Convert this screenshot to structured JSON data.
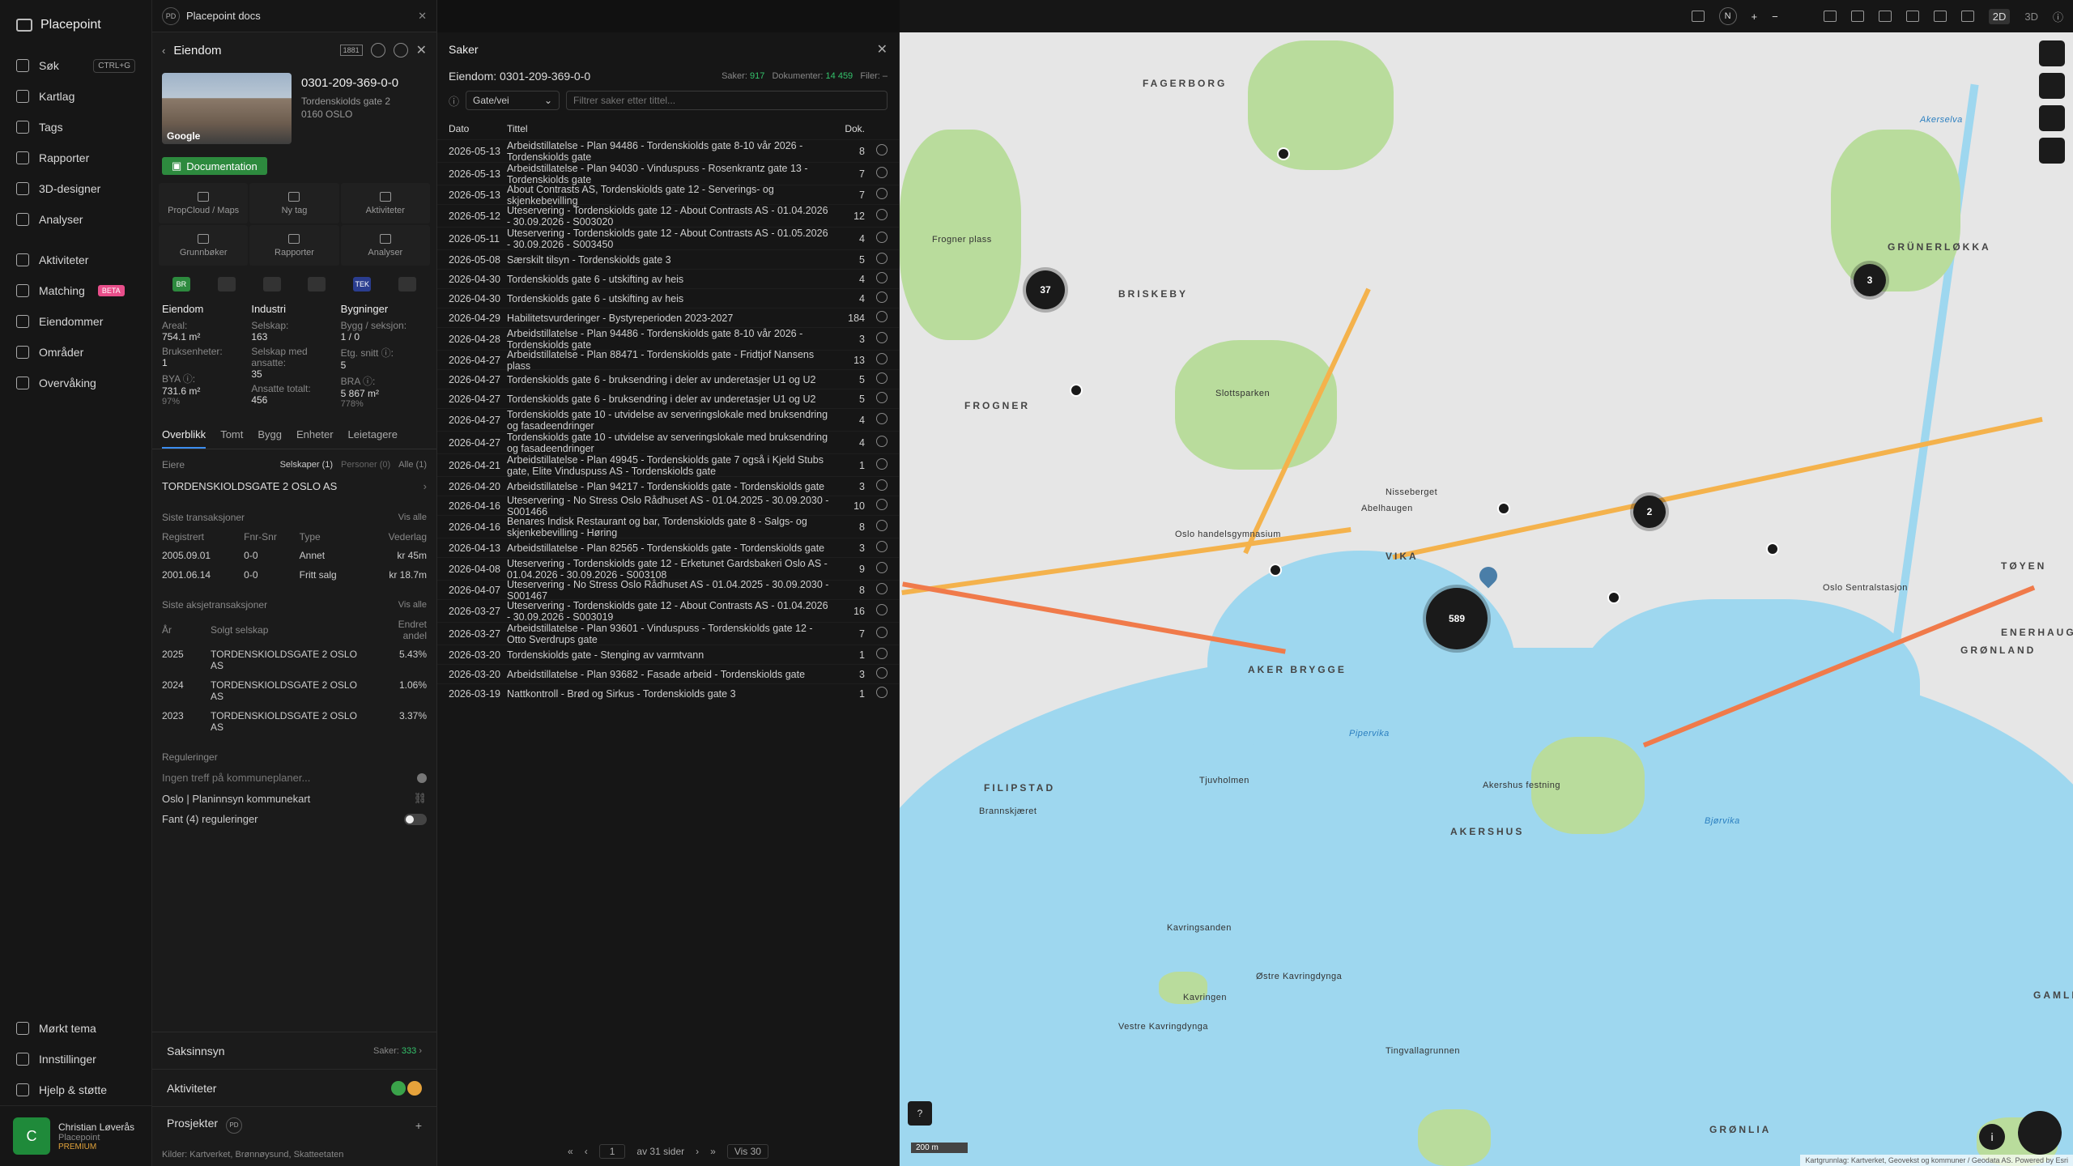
{
  "nav": {
    "brand": "Placepoint",
    "items": [
      {
        "label": "Søk",
        "kbd": "CTRL+G"
      },
      {
        "label": "Kartlag"
      },
      {
        "label": "Tags"
      },
      {
        "label": "Rapporter"
      },
      {
        "label": "3D-designer"
      },
      {
        "label": "Analyser"
      }
    ],
    "items2": [
      {
        "label": "Aktiviteter"
      },
      {
        "label": "Matching",
        "beta": "BETA"
      },
      {
        "label": "Eiendommer"
      },
      {
        "label": "Områder"
      },
      {
        "label": "Overvåking"
      }
    ],
    "bottom": [
      {
        "label": "Mørkt tema"
      },
      {
        "label": "Innstillinger"
      },
      {
        "label": "Hjelp & støtte"
      }
    ],
    "user": {
      "initial": "C",
      "name": "Christian Løverås",
      "org": "Placepoint",
      "plan": "PREMIUM"
    }
  },
  "topbar": {
    "badge": "PD",
    "doc_title": "Placepoint docs"
  },
  "property": {
    "header": "Eiendom",
    "header_badge": "1881",
    "id": "0301-209-369-0-0",
    "address_line1": "Tordenskiolds gate 2",
    "address_line2": "0160 OSLO",
    "photo_label": "Google",
    "doc_button": "Documentation",
    "actions": [
      "PropCloud / Maps",
      "Ny tag",
      "Aktiviteter",
      "Grunnbøker",
      "Rapporter",
      "Analyser"
    ],
    "chips": [
      "BR",
      "",
      "",
      "",
      "TEK",
      ""
    ],
    "stats": {
      "col1": {
        "head": "Eiendom",
        "rows": [
          [
            "Areal:",
            "754.1 m²"
          ],
          [
            "Bruksenheter:",
            "1"
          ],
          [
            "BYA ⓘ:",
            "731.6 m²"
          ]
        ],
        "note": "97%"
      },
      "col2": {
        "head": "Industri",
        "rows": [
          [
            "Selskap:",
            "163"
          ],
          [
            "Selskap med ansatte:",
            "35"
          ],
          [
            "Ansatte totalt:",
            "456"
          ]
        ]
      },
      "col3": {
        "head": "Bygninger",
        "rows": [
          [
            "Bygg / seksjon:",
            "1 / 0"
          ],
          [
            "Etg. snitt ⓘ:",
            "5"
          ],
          [
            "BRA ⓘ:",
            "5 867 m²"
          ]
        ],
        "note": "778%"
      }
    },
    "tabs": [
      "Overblikk",
      "Tomt",
      "Bygg",
      "Enheter",
      "Leietagere"
    ],
    "owners_label": "Eiere",
    "owners_filters": [
      "Selskaper (1)",
      "Personer (0)",
      "Alle (1)"
    ],
    "owner_name": "TORDENSKIOLDSGATE 2 OSLO AS",
    "transactions_label": "Siste transaksjoner",
    "see_all": "Vis alle",
    "tx_cols": [
      "Registrert",
      "Fnr-Snr",
      "Type",
      "Vederlag"
    ],
    "tx_rows": [
      [
        "2005.09.01",
        "0-0",
        "Annet",
        "kr 45m"
      ],
      [
        "2001.06.14",
        "0-0",
        "Fritt salg",
        "kr 18.7m"
      ]
    ],
    "share_label": "Siste aksjetransaksjoner",
    "share_cols": [
      "År",
      "Solgt selskap",
      "Endret andel"
    ],
    "share_rows": [
      [
        "2025",
        "TORDENSKIOLDSGATE 2 OSLO AS",
        "5.43%"
      ],
      [
        "2024",
        "TORDENSKIOLDSGATE 2 OSLO AS",
        "1.06%"
      ],
      [
        "2023",
        "TORDENSKIOLDSGATE 2 OSLO AS",
        "3.37%"
      ]
    ],
    "reg_label": "Reguleringer",
    "reg_rows": [
      "Ingen treff på kommuneplaner...",
      "Oslo | Planinnsyn kommunekart",
      "Fant (4) reguleringer"
    ],
    "bottom": {
      "saksinnsyn": "Saksinnsyn",
      "saker_label": "Saker:",
      "saker_count": "333",
      "aktiviteter": "Aktiviteter",
      "prosjekter": "Prosjekter",
      "prosjekter_badge": "PD",
      "sources": "Kilder: Kartverket, Brønnøysund, Skatteetaten"
    }
  },
  "saker": {
    "title": "Saker",
    "subtitle": "Eiendom: 0301-209-369-0-0",
    "saker_label": "Saker:",
    "saker_count": "917",
    "dok_label": "Dokumenter:",
    "dok_count": "14 459",
    "filer_label": "Filer:",
    "filer_count": "–",
    "select": "Gate/vei",
    "search_placeholder": "Filtrer saker etter tittel...",
    "cols": [
      "Dato",
      "Tittel",
      "Dok."
    ],
    "rows": [
      [
        "2026-05-13",
        "Arbeidstillatelse - Plan 94486 - Tordenskiolds gate 8-10 vår 2026 - Tordenskiolds gate",
        "8"
      ],
      [
        "2026-05-13",
        "Arbeidstillatelse - Plan 94030 - Vinduspuss - Rosenkrantz gate 13 - Tordenskiolds gate",
        "7"
      ],
      [
        "2026-05-13",
        "About Contrasts AS, Tordenskiolds gate 12 - Serverings- og skjenkebevilling",
        "7"
      ],
      [
        "2026-05-12",
        "Uteservering - Tordenskiolds gate 12 - About Contrasts AS - 01.04.2026 - 30.09.2026 - S003020",
        "12"
      ],
      [
        "2026-05-11",
        "Uteservering - Tordenskiolds gate 12 - About Contrasts AS - 01.05.2026 - 30.09.2026 - S003450",
        "4"
      ],
      [
        "2026-05-08",
        "Særskilt tilsyn - Tordenskiolds gate 3",
        "5"
      ],
      [
        "2026-04-30",
        "Tordenskiolds gate 6 - utskifting av heis",
        "4"
      ],
      [
        "2026-04-30",
        "Tordenskiolds gate 6 - utskifting av heis",
        "4"
      ],
      [
        "2026-04-29",
        "Habilitetsvurderinger - Bystyreperioden 2023-2027",
        "184"
      ],
      [
        "2026-04-28",
        "Arbeidstillatelse - Plan 94486 - Tordenskiolds gate 8-10 vår 2026 - Tordenskiolds gate",
        "3"
      ],
      [
        "2026-04-27",
        "Arbeidstillatelse - Plan 88471 - Tordenskiolds gate - Fridtjof Nansens plass",
        "13"
      ],
      [
        "2026-04-27",
        "Tordenskiolds gate 6 - bruksendring i deler av underetasjer U1 og U2",
        "5"
      ],
      [
        "2026-04-27",
        "Tordenskiolds gate 6 - bruksendring i deler av underetasjer U1 og U2",
        "5"
      ],
      [
        "2026-04-27",
        "Tordenskiolds gate 10 - utvidelse av serveringslokale med bruksendring og fasadeendringer",
        "4"
      ],
      [
        "2026-04-27",
        "Tordenskiolds gate 10 - utvidelse av serveringslokale med bruksendring og fasadeendringer",
        "4"
      ],
      [
        "2026-04-21",
        "Arbeidstillatelse - Plan 49945 - Tordenskiolds gate 7 også i Kjeld Stubs gate, Elite Vinduspuss AS - Tordenskiolds gate",
        "1"
      ],
      [
        "2026-04-20",
        "Arbeidstillatelse - Plan 94217 - Tordenskiolds gate - Tordenskiolds gate",
        "3"
      ],
      [
        "2026-04-16",
        "Uteservering - No Stress Oslo Rådhuset AS - 01.04.2025 - 30.09.2030 - S001466",
        "10"
      ],
      [
        "2026-04-16",
        "Benares Indisk Restaurant og bar, Tordenskiolds gate 8 - Salgs- og skjenkebevilling - Høring",
        "8"
      ],
      [
        "2026-04-13",
        "Arbeidstillatelse - Plan 82565 - Tordenskiolds gate - Tordenskiolds gate",
        "3"
      ],
      [
        "2026-04-08",
        "Uteservering - Tordenskiolds gate 12 - Erketunet Gardsbakeri Oslo AS - 01.04.2026 - 30.09.2026 - S003108",
        "9"
      ],
      [
        "2026-04-07",
        "Uteservering - No Stress Oslo Rådhuset AS - 01.04.2025 - 30.09.2030 - S001467",
        "8"
      ],
      [
        "2026-03-27",
        "Uteservering - Tordenskiolds gate 12 - About Contrasts AS - 01.04.2026 - 30.09.2026 - S003019",
        "16"
      ],
      [
        "2026-03-27",
        "Arbeidstillatelse - Plan 93601 - Vinduspuss - Tordenskiolds gate 12 - Otto Sverdrups gate",
        "7"
      ],
      [
        "2026-03-20",
        "Tordenskiolds gate - Stenging av varmtvann",
        "1"
      ],
      [
        "2026-03-20",
        "Arbeidstillatelse - Plan 93682 - Fasade arbeid - Tordenskiolds gate",
        "3"
      ],
      [
        "2026-03-19",
        "Nattkontroll - Brød og Sirkus - Tordenskiolds gate 3",
        "1"
      ]
    ],
    "pager": {
      "page": "1",
      "of": "av 31 sider",
      "per": "Vis 30"
    }
  },
  "maptop": {
    "compass": "N",
    "plus": "+",
    "minus": "−",
    "mode2d": "2D",
    "mode3d": "3D"
  },
  "map": {
    "districts": [
      "FAGERBORG",
      "BRISKEBY",
      "FROGNER",
      "GRÜNERLØKKA",
      "AKER BRYGGE",
      "FILIPSTAD",
      "AKERSHUS",
      "TØYEN",
      "GRØNLAND",
      "ENERHAUG",
      "GAMLE",
      "GRØNLIA",
      "VIKA"
    ],
    "places": [
      "Frogner plass",
      "Slottsparken",
      "Oslo Sentralstasjon",
      "Kavringsanden",
      "Kavringen",
      "Østre Kavringdynga",
      "Vestre Kavringdynga",
      "Tingvallagrunnen",
      "Pipervika",
      "Bjørvika",
      "Akerselva",
      "Nisseberget",
      "Abelhaugen",
      "Oslo handelsgymnasium",
      "Tjuvholmen",
      "Brannskjæret",
      "Akershus festning"
    ],
    "clusters": [
      "37",
      "3",
      "2",
      "589"
    ],
    "scale": "200 m",
    "attribution": "Kartgrunnlag: Kartverket, Geovekst og kommuner / Geodata AS. Powered by Esri",
    "help": "?",
    "info": "i"
  }
}
